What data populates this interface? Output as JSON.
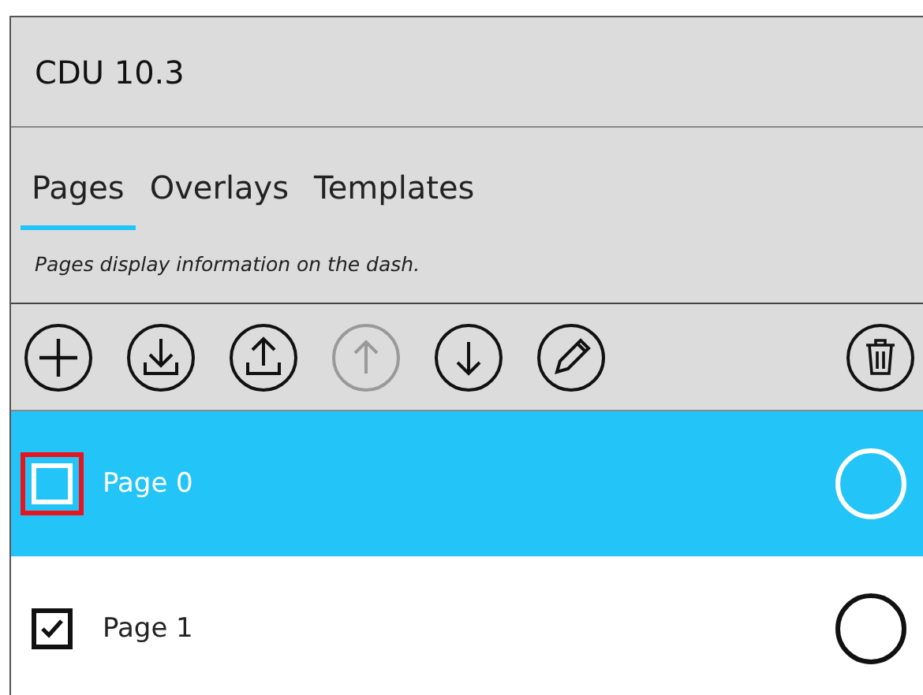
{
  "window": {
    "title": "CDU 10.3"
  },
  "tabs": [
    {
      "label": "Pages",
      "selected": true
    },
    {
      "label": "Overlays",
      "selected": false
    },
    {
      "label": "Templates",
      "selected": false
    }
  ],
  "description": "Pages display information on the dash.",
  "toolbar": [
    {
      "kind": "add",
      "disabled": false
    },
    {
      "kind": "import",
      "disabled": false
    },
    {
      "kind": "export",
      "disabled": false
    },
    {
      "kind": "move-up",
      "disabled": true
    },
    {
      "kind": "move-down",
      "disabled": false
    },
    {
      "kind": "edit",
      "disabled": false
    },
    {
      "kind": "delete",
      "disabled": false
    }
  ],
  "pages": [
    {
      "label": "Page 0",
      "selected": true,
      "checked": false,
      "focused": true,
      "default": false
    },
    {
      "label": "Page 1",
      "selected": false,
      "checked": true,
      "focused": false,
      "default": false
    }
  ]
}
